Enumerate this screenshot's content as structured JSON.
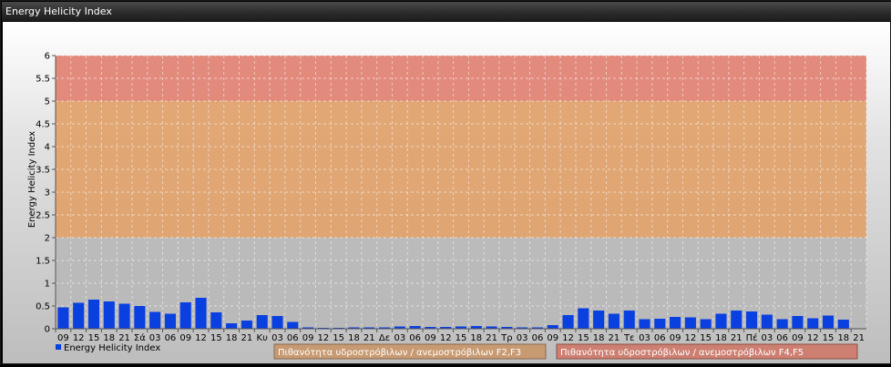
{
  "window": {
    "title": "Energy Helicity Index"
  },
  "colors": {
    "bar": "#0a3fe0",
    "band_low": "#b8b8b8",
    "band_mid": "#e0a068",
    "band_high": "#e08070",
    "legend_mid_bg": "#c79a72",
    "legend_high_bg": "#cd7f71"
  },
  "chart_data": {
    "type": "bar",
    "ylabel": "Energy Helicity Index",
    "ylim": [
      0,
      6
    ],
    "yticks": [
      "0",
      "0.5",
      "1",
      "1.5",
      "2",
      "2.5",
      "3",
      "3.5",
      "4",
      "4.5",
      "5",
      "5.5",
      "6"
    ],
    "categories": [
      "09",
      "12",
      "15",
      "18",
      "21",
      "Σά",
      "03",
      "06",
      "09",
      "12",
      "15",
      "18",
      "21",
      "Κυ",
      "03",
      "06",
      "09",
      "12",
      "15",
      "18",
      "21",
      "Δε",
      "03",
      "06",
      "09",
      "12",
      "15",
      "18",
      "21",
      "Τρ",
      "03",
      "06",
      "09",
      "12",
      "15",
      "18",
      "21",
      "Τε",
      "03",
      "06",
      "09",
      "12",
      "15",
      "18",
      "21",
      "Πέ",
      "03",
      "06",
      "09",
      "12",
      "15",
      "18",
      "21"
    ],
    "series": [
      {
        "name": "Energy Helicity Index",
        "values": [
          0.47,
          0.57,
          0.64,
          0.6,
          0.55,
          0.5,
          0.37,
          0.33,
          0.58,
          0.68,
          0.36,
          0.12,
          0.18,
          0.3,
          0.28,
          0.15,
          0.03,
          0.02,
          0.02,
          0.03,
          0.03,
          0.03,
          0.05,
          0.06,
          0.04,
          0.04,
          0.05,
          0.06,
          0.05,
          0.04,
          0.03,
          0.03,
          0.08,
          0.3,
          0.45,
          0.4,
          0.33,
          0.4,
          0.21,
          0.22,
          0.26,
          0.25,
          0.21,
          0.33,
          0.4,
          0.38,
          0.31,
          0.21,
          0.28,
          0.23,
          0.29,
          0.2
        ]
      }
    ],
    "bands": [
      {
        "from": 0,
        "to": 2
      },
      {
        "from": 2,
        "to": 5,
        "label": "Πιθανότητα υδροστρόβιλων / ανεμοστρόβιλων F2,F3"
      },
      {
        "from": 5,
        "to": 6,
        "label": "Πιθανότητα υδροστρόβιλων / ανεμοστρόβιλων F4,F5"
      }
    ],
    "grid": true,
    "legend": "bottom-left"
  }
}
